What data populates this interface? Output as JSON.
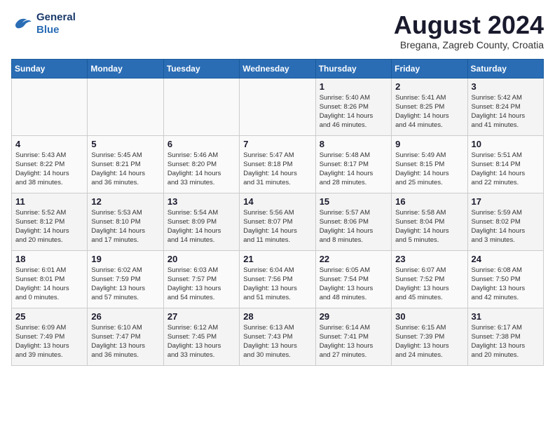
{
  "logo": {
    "line1": "General",
    "line2": "Blue"
  },
  "title": "August 2024",
  "location": "Bregana, Zagreb County, Croatia",
  "days_of_week": [
    "Sunday",
    "Monday",
    "Tuesday",
    "Wednesday",
    "Thursday",
    "Friday",
    "Saturday"
  ],
  "weeks": [
    [
      {
        "day": "",
        "info": ""
      },
      {
        "day": "",
        "info": ""
      },
      {
        "day": "",
        "info": ""
      },
      {
        "day": "",
        "info": ""
      },
      {
        "day": "1",
        "info": "Sunrise: 5:40 AM\nSunset: 8:26 PM\nDaylight: 14 hours\nand 46 minutes."
      },
      {
        "day": "2",
        "info": "Sunrise: 5:41 AM\nSunset: 8:25 PM\nDaylight: 14 hours\nand 44 minutes."
      },
      {
        "day": "3",
        "info": "Sunrise: 5:42 AM\nSunset: 8:24 PM\nDaylight: 14 hours\nand 41 minutes."
      }
    ],
    [
      {
        "day": "4",
        "info": "Sunrise: 5:43 AM\nSunset: 8:22 PM\nDaylight: 14 hours\nand 38 minutes."
      },
      {
        "day": "5",
        "info": "Sunrise: 5:45 AM\nSunset: 8:21 PM\nDaylight: 14 hours\nand 36 minutes."
      },
      {
        "day": "6",
        "info": "Sunrise: 5:46 AM\nSunset: 8:20 PM\nDaylight: 14 hours\nand 33 minutes."
      },
      {
        "day": "7",
        "info": "Sunrise: 5:47 AM\nSunset: 8:18 PM\nDaylight: 14 hours\nand 31 minutes."
      },
      {
        "day": "8",
        "info": "Sunrise: 5:48 AM\nSunset: 8:17 PM\nDaylight: 14 hours\nand 28 minutes."
      },
      {
        "day": "9",
        "info": "Sunrise: 5:49 AM\nSunset: 8:15 PM\nDaylight: 14 hours\nand 25 minutes."
      },
      {
        "day": "10",
        "info": "Sunrise: 5:51 AM\nSunset: 8:14 PM\nDaylight: 14 hours\nand 22 minutes."
      }
    ],
    [
      {
        "day": "11",
        "info": "Sunrise: 5:52 AM\nSunset: 8:12 PM\nDaylight: 14 hours\nand 20 minutes."
      },
      {
        "day": "12",
        "info": "Sunrise: 5:53 AM\nSunset: 8:10 PM\nDaylight: 14 hours\nand 17 minutes."
      },
      {
        "day": "13",
        "info": "Sunrise: 5:54 AM\nSunset: 8:09 PM\nDaylight: 14 hours\nand 14 minutes."
      },
      {
        "day": "14",
        "info": "Sunrise: 5:56 AM\nSunset: 8:07 PM\nDaylight: 14 hours\nand 11 minutes."
      },
      {
        "day": "15",
        "info": "Sunrise: 5:57 AM\nSunset: 8:06 PM\nDaylight: 14 hours\nand 8 minutes."
      },
      {
        "day": "16",
        "info": "Sunrise: 5:58 AM\nSunset: 8:04 PM\nDaylight: 14 hours\nand 5 minutes."
      },
      {
        "day": "17",
        "info": "Sunrise: 5:59 AM\nSunset: 8:02 PM\nDaylight: 14 hours\nand 3 minutes."
      }
    ],
    [
      {
        "day": "18",
        "info": "Sunrise: 6:01 AM\nSunset: 8:01 PM\nDaylight: 14 hours\nand 0 minutes."
      },
      {
        "day": "19",
        "info": "Sunrise: 6:02 AM\nSunset: 7:59 PM\nDaylight: 13 hours\nand 57 minutes."
      },
      {
        "day": "20",
        "info": "Sunrise: 6:03 AM\nSunset: 7:57 PM\nDaylight: 13 hours\nand 54 minutes."
      },
      {
        "day": "21",
        "info": "Sunrise: 6:04 AM\nSunset: 7:56 PM\nDaylight: 13 hours\nand 51 minutes."
      },
      {
        "day": "22",
        "info": "Sunrise: 6:05 AM\nSunset: 7:54 PM\nDaylight: 13 hours\nand 48 minutes."
      },
      {
        "day": "23",
        "info": "Sunrise: 6:07 AM\nSunset: 7:52 PM\nDaylight: 13 hours\nand 45 minutes."
      },
      {
        "day": "24",
        "info": "Sunrise: 6:08 AM\nSunset: 7:50 PM\nDaylight: 13 hours\nand 42 minutes."
      }
    ],
    [
      {
        "day": "25",
        "info": "Sunrise: 6:09 AM\nSunset: 7:49 PM\nDaylight: 13 hours\nand 39 minutes."
      },
      {
        "day": "26",
        "info": "Sunrise: 6:10 AM\nSunset: 7:47 PM\nDaylight: 13 hours\nand 36 minutes."
      },
      {
        "day": "27",
        "info": "Sunrise: 6:12 AM\nSunset: 7:45 PM\nDaylight: 13 hours\nand 33 minutes."
      },
      {
        "day": "28",
        "info": "Sunrise: 6:13 AM\nSunset: 7:43 PM\nDaylight: 13 hours\nand 30 minutes."
      },
      {
        "day": "29",
        "info": "Sunrise: 6:14 AM\nSunset: 7:41 PM\nDaylight: 13 hours\nand 27 minutes."
      },
      {
        "day": "30",
        "info": "Sunrise: 6:15 AM\nSunset: 7:39 PM\nDaylight: 13 hours\nand 24 minutes."
      },
      {
        "day": "31",
        "info": "Sunrise: 6:17 AM\nSunset: 7:38 PM\nDaylight: 13 hours\nand 20 minutes."
      }
    ]
  ]
}
